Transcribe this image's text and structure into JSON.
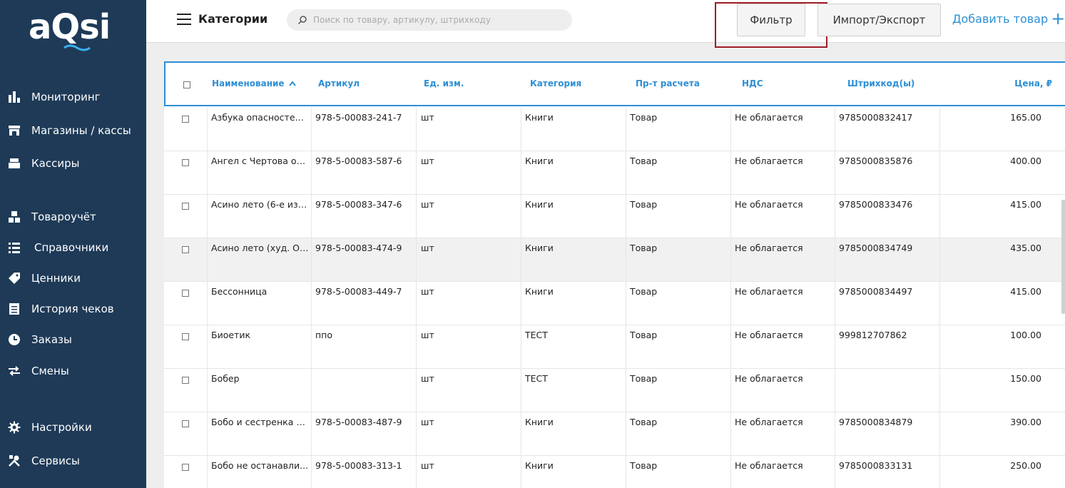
{
  "sidebar": {
    "logo": "aQsi",
    "items": [
      {
        "label": "Мониторинг",
        "icon": "bar-chart-icon"
      },
      {
        "label": "Магазины / кассы",
        "icon": "store-icon"
      },
      {
        "label": "Кассиры",
        "icon": "cash-register-icon"
      },
      {
        "label": "Товароучёт",
        "icon": "boxes-icon"
      },
      {
        "label": "Справочники",
        "icon": "list-icon"
      },
      {
        "label": "Ценники",
        "icon": "tag-icon"
      },
      {
        "label": "История чеков",
        "icon": "receipt-icon"
      },
      {
        "label": "Заказы",
        "icon": "clock-icon"
      },
      {
        "label": "Смены",
        "icon": "swap-icon"
      },
      {
        "label": "Настройки",
        "icon": "gear-icon"
      },
      {
        "label": "Сервисы",
        "icon": "tools-icon"
      }
    ]
  },
  "header": {
    "title": "Категории",
    "search_placeholder": "Поиск по товару, артикулу, штрихкоду",
    "filter_label": "Фильтр",
    "import_label": "Импорт/Экспорт",
    "add_label": "Добавить товар",
    "add_plus": "+"
  },
  "table": {
    "columns": [
      "Наименование",
      "Артикул",
      "Ед. изм.",
      "Категория",
      "Пр-т расчета",
      "НДС",
      "Штрихкод(ы)",
      "Цена, ₽"
    ],
    "rows": [
      {
        "name": "Азбука опасностей ...",
        "sku": "978-5-00083-241-7",
        "unit": "шт",
        "category": "Книги",
        "calc": "Товар",
        "vat": "Не облагается",
        "barcode": "9785000832417",
        "price": "165.00"
      },
      {
        "name": "Ангел с Чертова ост...",
        "sku": "978-5-00083-587-6",
        "unit": "шт",
        "category": "Книги",
        "calc": "Товар",
        "vat": "Не облагается",
        "barcode": "9785000835876",
        "price": "400.00"
      },
      {
        "name": "Асино лето (6-е изд.)",
        "sku": "978-5-00083-347-6",
        "unit": "шт",
        "category": "Книги",
        "calc": "Товар",
        "vat": "Не облагается",
        "barcode": "9785000833476",
        "price": "415.00"
      },
      {
        "name": "Асино лето (худ. О. ...",
        "sku": "978-5-00083-474-9",
        "unit": "шт",
        "category": "Книги",
        "calc": "Товар",
        "vat": "Не облагается",
        "barcode": "9785000834749",
        "price": "435.00"
      },
      {
        "name": "Бессонница",
        "sku": "978-5-00083-449-7",
        "unit": "шт",
        "category": "Книги",
        "calc": "Товар",
        "vat": "Не облагается",
        "barcode": "9785000834497",
        "price": "415.00"
      },
      {
        "name": "Биоетик",
        "sku": "ппо",
        "unit": "шт",
        "category": "ТЕСТ",
        "calc": "Товар",
        "vat": "Не облагается",
        "barcode": "999812707862",
        "price": "100.00"
      },
      {
        "name": "Бобер",
        "sku": "",
        "unit": "шт",
        "category": "ТЕСТ",
        "calc": "Товар",
        "vat": "Не облагается",
        "barcode": "",
        "price": "150.00"
      },
      {
        "name": "Бобо и сестренка Б...",
        "sku": "978-5-00083-487-9",
        "unit": "шт",
        "category": "Книги",
        "calc": "Товар",
        "vat": "Не облагается",
        "barcode": "9785000834879",
        "price": "390.00"
      },
      {
        "name": "Бобо не останавли...",
        "sku": "978-5-00083-313-1",
        "unit": "шт",
        "category": "Книги",
        "calc": "Товар",
        "vat": "Не облагается",
        "barcode": "9785000833131",
        "price": "250.00"
      }
    ]
  },
  "colors": {
    "sidebar": "#1e3a57",
    "accent": "#2d8fd5",
    "highlight_frame": "#9e1c24"
  }
}
